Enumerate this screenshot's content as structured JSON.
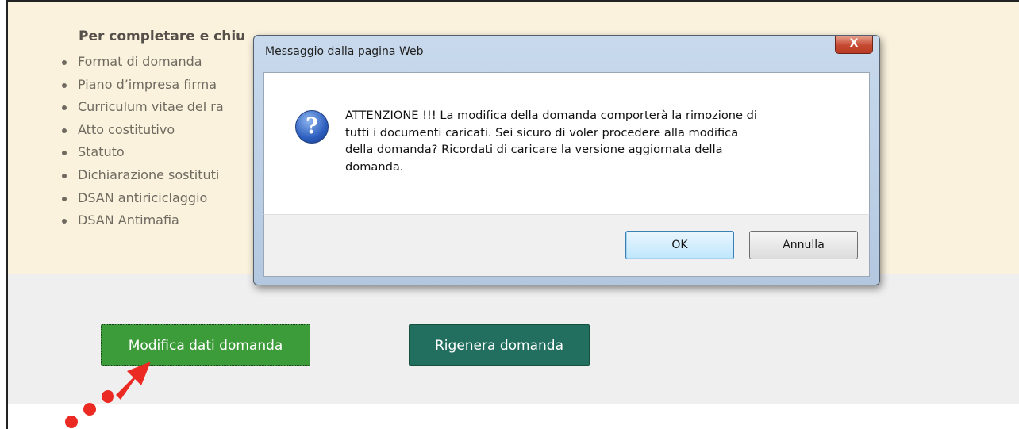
{
  "page": {
    "heading": "Per completare e chiu",
    "documents": [
      "Format di domanda",
      "Piano d’impresa firma",
      "Curriculum vitae del ra",
      "Atto costitutivo",
      "Statuto",
      "Dichiarazione sostituti",
      "DSAN antiriciclaggio",
      "DSAN Antimafia"
    ],
    "buttons": {
      "modifica": "Modifica dati domanda",
      "rigenera": "Rigenera domanda"
    }
  },
  "dialog": {
    "title": "Messaggio dalla pagina Web",
    "close_glyph": "X",
    "icon": "question-icon",
    "message_lines": [
      "ATTENZIONE !!! La modifica della domanda comporterà la rimozione di",
      "tutti i documenti caricati. Sei sicuro di voler procedere alla modifica",
      "della domanda? Ricordati di caricare la versione aggiornata della",
      "domanda."
    ],
    "ok_label": "OK",
    "cancel_label": "Annulla"
  },
  "colors": {
    "panel_bg": "#fbf2de",
    "modifica_btn": "#3d9c3a",
    "rigenera_btn": "#226f5f",
    "arrow": "#ea2a23"
  }
}
